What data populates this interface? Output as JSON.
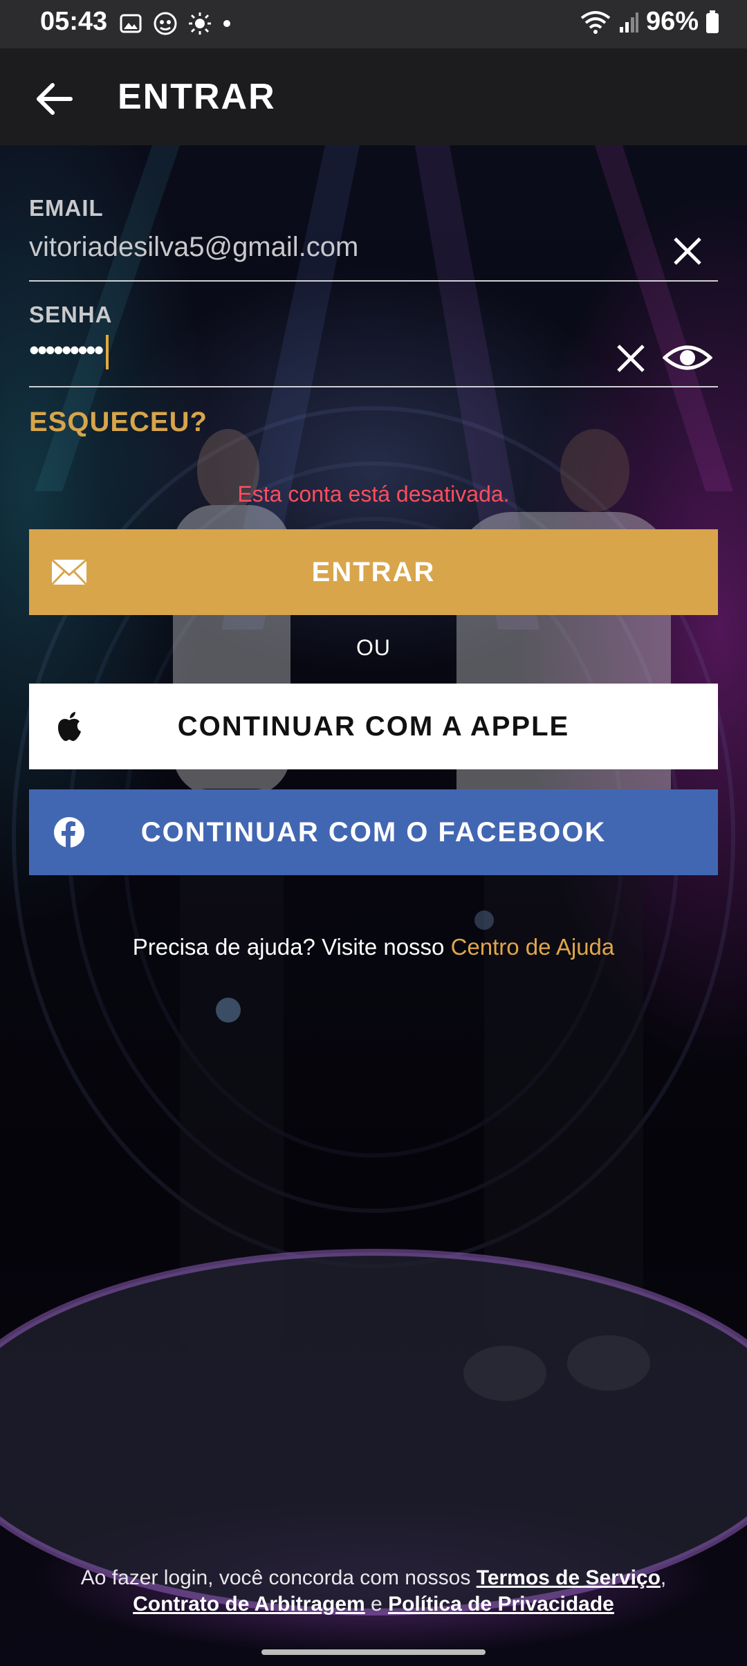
{
  "status_bar": {
    "time": "05:43",
    "battery": "96%",
    "icons": [
      "gallery-icon",
      "app-notification-icon",
      "brightness-icon",
      "dot-icon",
      "wifi-icon",
      "signal-icon",
      "battery-icon"
    ]
  },
  "app_bar": {
    "title": "ENTRAR",
    "back_icon": "arrow-left-icon"
  },
  "form": {
    "email_label": "EMAIL",
    "email_value": "vitoriadesilva5@gmail.com",
    "password_label": "SENHA",
    "password_value": "•••••••••",
    "forgot_label": "ESQUECEU?",
    "error_text": "Esta conta está desativada."
  },
  "buttons": {
    "enter_label": "ENTRAR",
    "or_label": "OU",
    "apple_label": "CONTINUAR COM A APPLE",
    "facebook_label": "CONTINUAR COM O FACEBOOK"
  },
  "help": {
    "text": "Precisa de ajuda? Visite nosso ",
    "link": "Centro de Ajuda"
  },
  "legal": {
    "prefix": "Ao fazer login, você concorda com nossos ",
    "terms": "Termos de Serviço",
    "comma": ",",
    "arbitration": "Contrato de Arbitragem",
    "and": " e ",
    "privacy": "Política de Privacidade"
  },
  "colors": {
    "accent": "#d8a54b",
    "error": "#ff4d5e",
    "facebook": "#4267b2",
    "app_bar": "#1c1c1e",
    "status_bar": "#2c2c2e"
  }
}
